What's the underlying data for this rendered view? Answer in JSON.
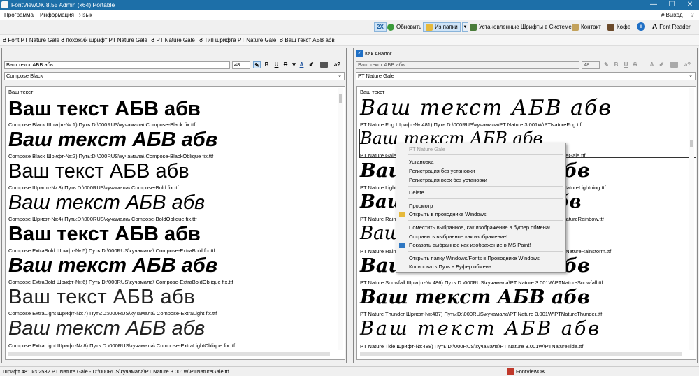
{
  "title": "FontViewOK 8.55 Admin (x64) Portable",
  "window_controls": {
    "minimize": "—",
    "maximize": "☐",
    "close": "✕"
  },
  "menu": {
    "items": [
      "Программа",
      "Информация",
      "Язык"
    ],
    "exit": "# Выход",
    "help": "?"
  },
  "toolbar": {
    "zoom": "2X",
    "refresh": "Обновить",
    "from_folder": "Из папки",
    "installed": "Установленные Шрифты в Системе",
    "contact": "Контакт",
    "coffee": "Кофе",
    "info": "i",
    "reader": "Font Reader"
  },
  "favorites": [
    "Font PT Nature Gale",
    "похожий шрифт  PT Nature Gale",
    "PT Nature Gale",
    "Тип шрифта  PT Nature Gale",
    "Ваш текст АБВ абв"
  ],
  "left": {
    "text_input": "Ваш текст АБВ абв",
    "size": "48",
    "font_select": "Compose Black",
    "header": "Ваш текст",
    "items": [
      {
        "sample": "Ваш текст АБВ абв",
        "caption": "Compose Black Шрифт-№:1) Путь:D:\\000RUS\\кучамала\\ Compose-Black fix.ttf"
      },
      {
        "sample": "Ваш текст АБВ абв",
        "caption": "Compose Black Шрифт-№:2) Путь:D:\\000RUS\\кучамала\\ Compose-BlackOblique fix.ttf"
      },
      {
        "sample": "Ваш текст АБВ абв",
        "caption": "Compose Шрифт-№:3) Путь:D:\\000RUS\\кучамала\\ Compose-Bold fix.ttf"
      },
      {
        "sample": "Ваш текст АБВ абв",
        "caption": "Compose Шрифт-№:4) Путь:D:\\000RUS\\кучамала\\ Compose-BoldOblique fix.ttf"
      },
      {
        "sample": "Ваш текст АБВ абв",
        "caption": "Compose ExtraBold Шрифт-№:5) Путь:D:\\000RUS\\кучамала\\ Compose-ExtraBold fix.ttf"
      },
      {
        "sample": "Ваш текст АБВ абв",
        "caption": "Compose ExtraBold Шрифт-№:6) Путь:D:\\000RUS\\кучамала\\ Compose-ExtraBoldOblique fix.ttf"
      },
      {
        "sample": "Ваш текст АБВ абв",
        "caption": "Compose ExtraLight Шрифт-№:7) Путь:D:\\000RUS\\кучамала\\ Compose-ExtraLight fix.ttf"
      },
      {
        "sample": "Ваш текст АБВ абв",
        "caption": "Compose ExtraLight Шрифт-№:8) Путь:D:\\000RUS\\кучамала\\ Compose-ExtraLightOblique fix.ttf"
      }
    ]
  },
  "right": {
    "checkbox_label": "Как Аналог",
    "text_input": "Ваш текст АБВ абв",
    "size": "48",
    "font_select": "PT Nature Gale",
    "header": "Ваш текст",
    "items": [
      {
        "sample": "Ваш текст АБВ абв",
        "caption": "PT Nature Fog Шрифт-№:481) Путь:D:\\000RUS\\кучамала\\PT Nature 3.001W\\PTNatureFog.ttf"
      },
      {
        "sample": "Ваш текст АБВ абв",
        "caption": "PT Nature Gale Шрифт-№:482) Путь:D:\\000RUS\\кучамала\\PT Nature 3.001W\\PTNatureGale.ttf"
      },
      {
        "sample": "Ваш текст АБВ абв",
        "caption": "PT Nature Lightning Шрифт-№:483) Путь:D:\\000RUS\\кучамала\\PT Nature 3.001W\\PTNatureLightning.ttf"
      },
      {
        "sample": "Ваш текст АБВ абв",
        "caption": "PT Nature Rainbow Шрифт-№:484) Путь:D:\\000RUS\\кучамала\\PT Nature 3.001W\\PTNatureRainbow.ttf"
      },
      {
        "sample": "Ваш текст АБВ абв",
        "caption": "PT Nature Rainstorm Шрифт-№:485) Путь:D:\\000RUS\\кучамала\\PT Nature 3.001W\\PTNatureRainstorm.ttf"
      },
      {
        "sample": "Ваш текст АБВ абв",
        "caption": "PT Nature Snowfall Шрифт-№:486) Путь:D:\\000RUS\\кучамала\\PT Nature 3.001W\\PTNatureSnowfall.ttf"
      },
      {
        "sample": "Ваш текст АБВ абв",
        "caption": "PT Nature Thunder Шрифт-№:487) Путь:D:\\000RUS\\кучамала\\PT Nature 3.001W\\PTNatureThunder.ttf"
      },
      {
        "sample": "Ваш текст АБВ абв",
        "caption": "PT Nature Tide Шрифт-№:488) Путь:D:\\000RUS\\кучамала\\PT Nature 3.001W\\PTNatureTide.ttf"
      }
    ]
  },
  "context_menu": {
    "header": "PT Nature Gale",
    "items": [
      "Установка",
      "Регистрация без установки",
      "Регистрация всех без установки",
      "Delete",
      "Просмотр",
      "Открыть в проводнике Windows",
      "Поместить выбранное, как изображение в буфер обмена!",
      "Сохранить выбранное как изображение!",
      "Показать выбранное как изображение в MS Paint!",
      "Открыть папку Windows/Fonts в Проводнике Windows",
      "Копировать Путь в Буфер обмена"
    ]
  },
  "status": {
    "text": "Шрифт 481 из 2532 PT Nature Gale - D:\\000RUS\\кучамала\\PT Nature 3.001W\\PTNatureGale.ttf",
    "app": "FontViewOK"
  },
  "colors": {
    "titlebar": "#1d6fa8",
    "accent": "#2f77c2"
  }
}
